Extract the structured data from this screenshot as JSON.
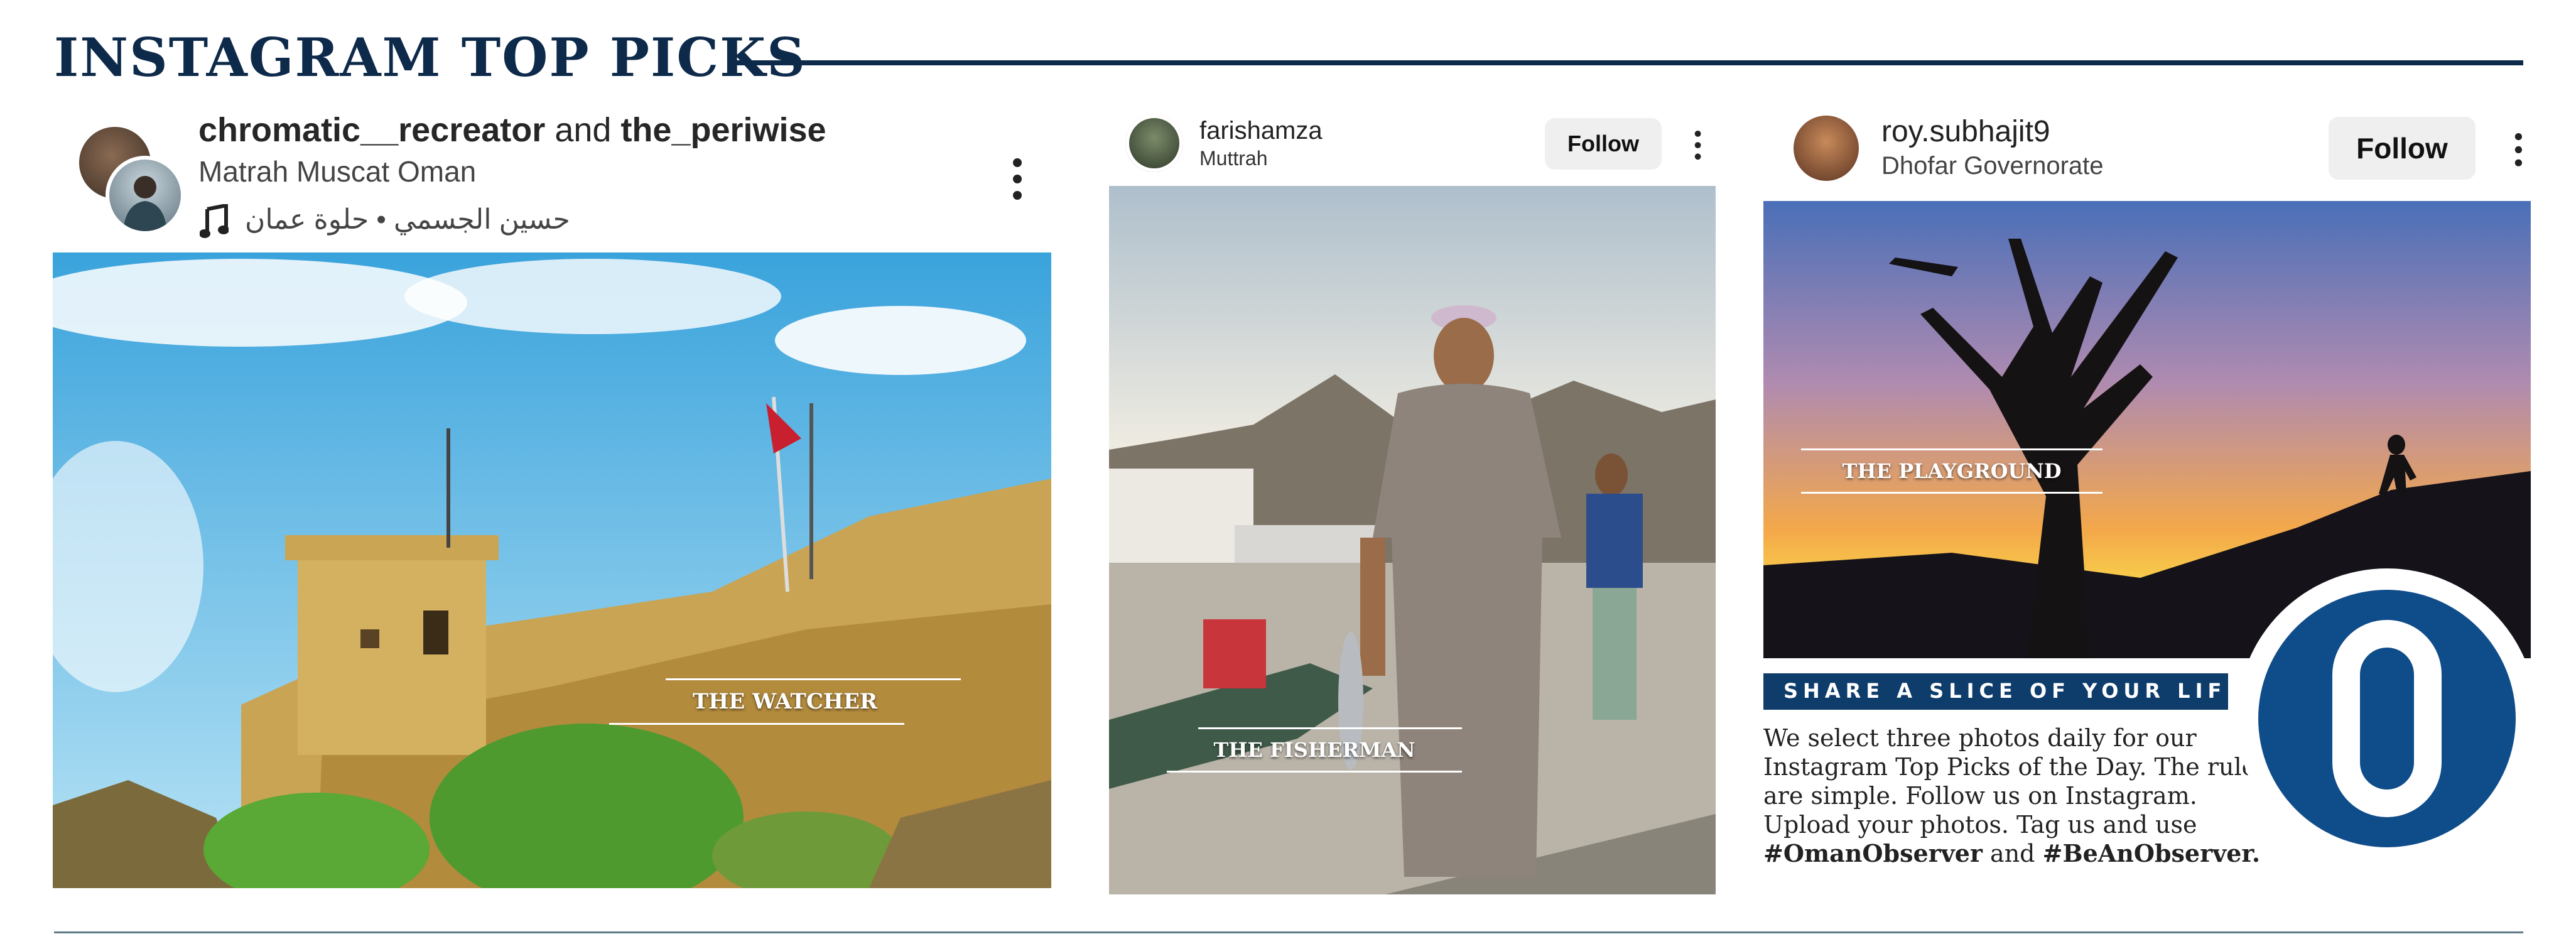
{
  "header": {
    "title": "INSTAGRAM TOP PICKS"
  },
  "posts": [
    {
      "user_a": "chromatic__recreator",
      "joiner": "and",
      "user_b": "the_periwise",
      "location": "Matrah Muscat Oman",
      "music": "حسين الجسمي • حلوة عمان",
      "caption": "THE WATCHER"
    },
    {
      "username": "farishamza",
      "location": "Muttrah",
      "follow_label": "Follow",
      "caption": "THE FISHERMAN"
    },
    {
      "username": "roy.subhajit9",
      "location": "Dhofar Governorate",
      "follow_label": "Follow",
      "caption": "THE PLAYGROUND"
    }
  ],
  "promo": {
    "band": "SHARE A SLICE OF YOUR LIFE",
    "text": "We select three photos daily for our Instagram Top Picks of the Day. The rules are simple. Follow us on Instagram. Upload your photos. Tag us and use",
    "hashtag1": "#OmanObserver",
    "and": "and",
    "hashtag2": "#BeAnObserver.",
    "logo_letter": "O"
  },
  "icons": {
    "music": "music-note-icon",
    "more": "more-vertical-icon"
  },
  "colors": {
    "brand_navy": "#0e2a4a",
    "band_blue": "#0e3c6b",
    "logo_blue": "#0f4c8a"
  }
}
